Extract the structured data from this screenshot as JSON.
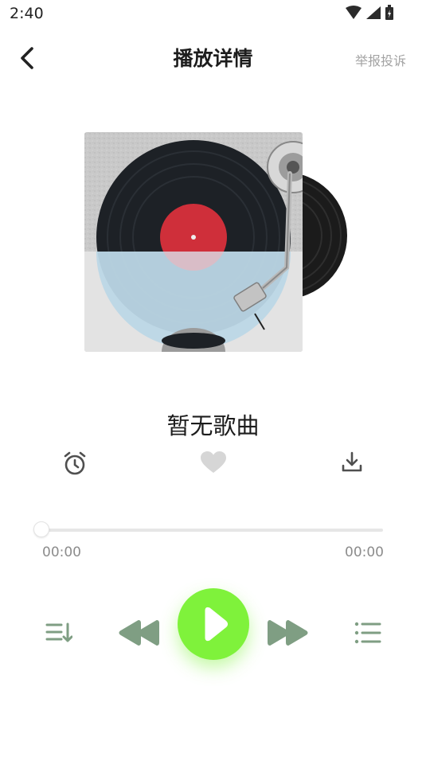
{
  "status_bar": {
    "time": "2:40"
  },
  "header": {
    "title": "播放详情",
    "report_label": "举报投诉"
  },
  "song": {
    "title": "暂无歌曲"
  },
  "progress": {
    "current": "00:00",
    "total": "00:00",
    "fraction": 0
  },
  "colors": {
    "accent": "#7ff23b",
    "controls": "#7f9e83",
    "icons": "#5a5a5a"
  },
  "icons": {
    "back": "chevron-left-icon",
    "alarm": "alarm-clock-icon",
    "like": "heart-icon",
    "download": "download-icon",
    "order": "play-order-icon",
    "prev": "rewind-icon",
    "play": "play-icon",
    "next": "fast-forward-icon",
    "list": "playlist-icon"
  }
}
